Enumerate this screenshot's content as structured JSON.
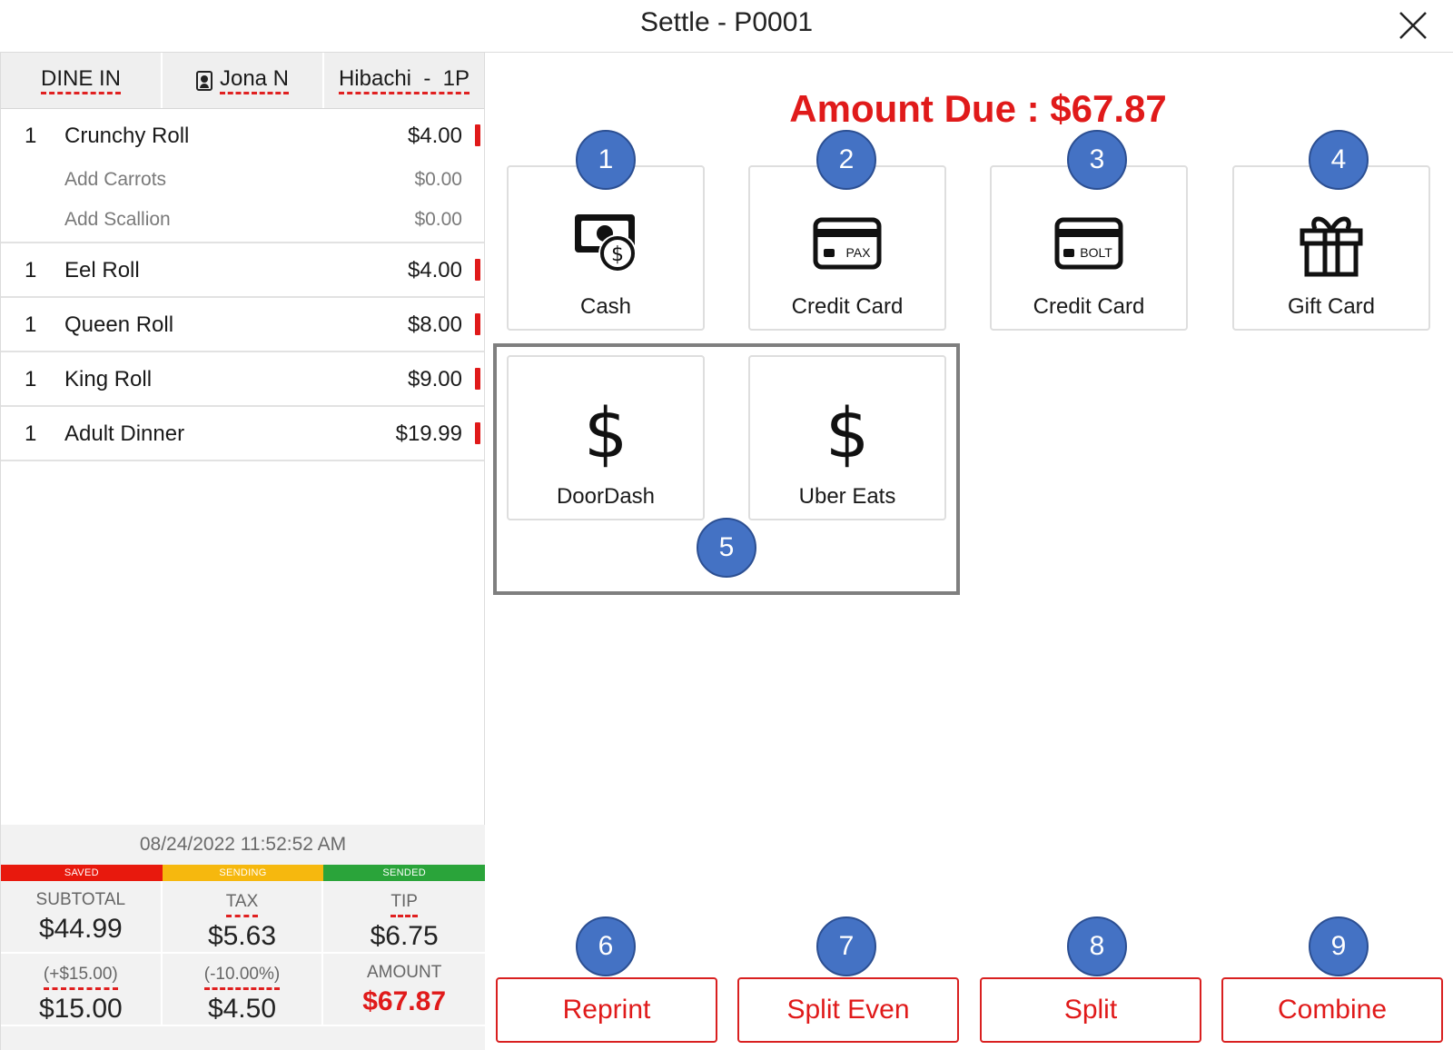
{
  "window": {
    "title": "Settle - P0001"
  },
  "order_tabs": {
    "type": "DINE IN",
    "server": "Jona N",
    "table": "Hibachi  -  1P"
  },
  "items": [
    {
      "qty": "1",
      "name": "Crunchy Roll",
      "price": "$4.00",
      "modifiers": [
        {
          "name": "Add Carrots",
          "price": "$0.00"
        },
        {
          "name": "Add Scallion",
          "price": "$0.00"
        }
      ]
    },
    {
      "qty": "1",
      "name": "Eel Roll",
      "price": "$4.00"
    },
    {
      "qty": "1",
      "name": "Queen Roll",
      "price": "$8.00"
    },
    {
      "qty": "1",
      "name": "King Roll",
      "price": "$9.00"
    },
    {
      "qty": "1",
      "name": "Adult Dinner",
      "price": "$19.99"
    }
  ],
  "footer": {
    "timestamp": "08/24/2022 11:52:52 AM",
    "status": {
      "saved": "SAVED",
      "sending": "SENDING",
      "sended": "SENDED"
    },
    "status_colors": {
      "saved": "#e8190d",
      "sending": "#f6b80e",
      "sended": "#2aa43a"
    },
    "subtotal_label": "SUBTOTAL",
    "subtotal": "$44.99",
    "tax_label": "TAX",
    "tax": "$5.63",
    "tip_label": "TIP",
    "tip": "$6.75",
    "surcharge_label": "(+$15.00)",
    "surcharge": "$15.00",
    "discount_label": "(-10.00%)",
    "discount": "$4.50",
    "amount_label": "AMOUNT",
    "amount": "$67.87"
  },
  "amount_due": "Amount Due : $67.87",
  "payment_methods": {
    "cash": "Cash",
    "credit_pax": "Credit Card",
    "credit_bolt": "Credit Card",
    "gift": "Gift Card",
    "doordash": "DoorDash",
    "ubereats": "Uber Eats",
    "pax_text": "PAX",
    "bolt_text": "BOLT",
    "dollar": "$"
  },
  "badges": [
    "1",
    "2",
    "3",
    "4",
    "5",
    "6",
    "7",
    "8",
    "9"
  ],
  "actions": {
    "reprint": "Reprint",
    "split_even": "Split Even",
    "split": "Split",
    "combine": "Combine"
  },
  "colors": {
    "accent_red": "#e01a1a",
    "badge_blue": "#4472c4"
  }
}
